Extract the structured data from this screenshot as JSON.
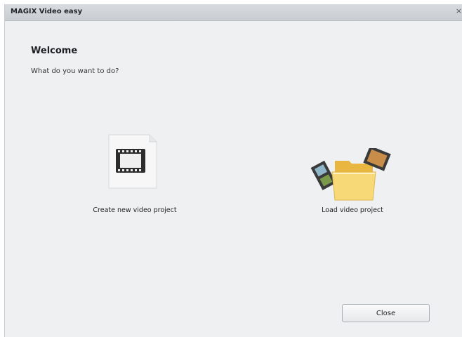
{
  "window": {
    "title": "MAGIX Video easy",
    "close_glyph": "×"
  },
  "main": {
    "heading": "Welcome",
    "subheading": "What do you want to do?"
  },
  "options": {
    "create": {
      "label": "Create new video project",
      "icon": "new-document-film-icon"
    },
    "load": {
      "label": "Load video project",
      "icon": "folder-film-icon"
    }
  },
  "footer": {
    "close_label": "Close"
  }
}
